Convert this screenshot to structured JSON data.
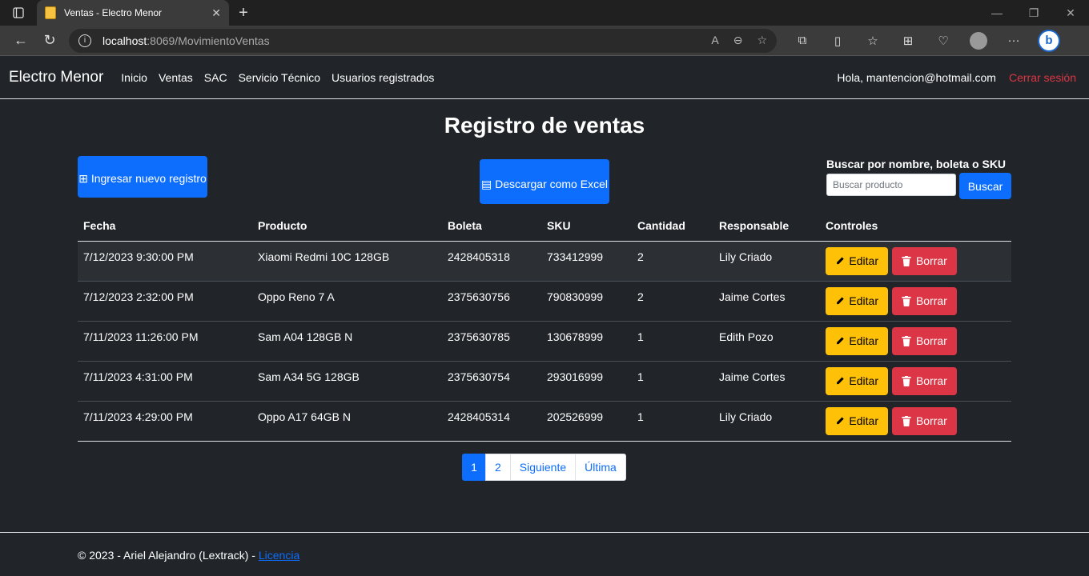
{
  "browser": {
    "tab_title": "Ventas - Electro Menor",
    "url_host": "localhost",
    "url_path": ":8069/MovimientoVentas"
  },
  "nav": {
    "brand": "Electro Menor",
    "links": [
      "Inicio",
      "Ventas",
      "SAC",
      "Servicio Técnico",
      "Usuarios registrados"
    ],
    "greeting": "Hola, mantencion@hotmail.com",
    "logout": "Cerrar sesión"
  },
  "page": {
    "title": "Registro de ventas",
    "new_button": "Ingresar nuevo registro",
    "excel_button": "Descargar como Excel",
    "search_label": "Buscar por nombre, boleta o SKU",
    "search_placeholder": "Buscar producto",
    "search_button": "Buscar"
  },
  "table": {
    "headers": [
      "Fecha",
      "Producto",
      "Boleta",
      "SKU",
      "Cantidad",
      "Responsable",
      "Controles"
    ],
    "edit_label": "Editar",
    "delete_label": "Borrar",
    "rows": [
      [
        "7/12/2023 9:30:00 PM",
        "Xiaomi Redmi 10C 128GB",
        "2428405318",
        "733412999",
        "2",
        "Lily Criado"
      ],
      [
        "7/12/2023 2:32:00 PM",
        "Oppo Reno 7 A",
        "2375630756",
        "790830999",
        "2",
        "Jaime Cortes"
      ],
      [
        "7/11/2023 11:26:00 PM",
        "Sam A04 128GB N",
        "2375630785",
        "130678999",
        "1",
        "Edith Pozo"
      ],
      [
        "7/11/2023 4:31:00 PM",
        "Sam A34 5G 128GB",
        "2375630754",
        "293016999",
        "1",
        "Jaime Cortes"
      ],
      [
        "7/11/2023 4:29:00 PM",
        "Oppo A17 64GB N",
        "2428405314",
        "202526999",
        "1",
        "Lily Criado"
      ]
    ]
  },
  "pagination": [
    "1",
    "2",
    "Siguiente",
    "Última"
  ],
  "footer": {
    "text": "© 2023 - Ariel Alejandro (Lextrack) - ",
    "link": "Licencia"
  }
}
